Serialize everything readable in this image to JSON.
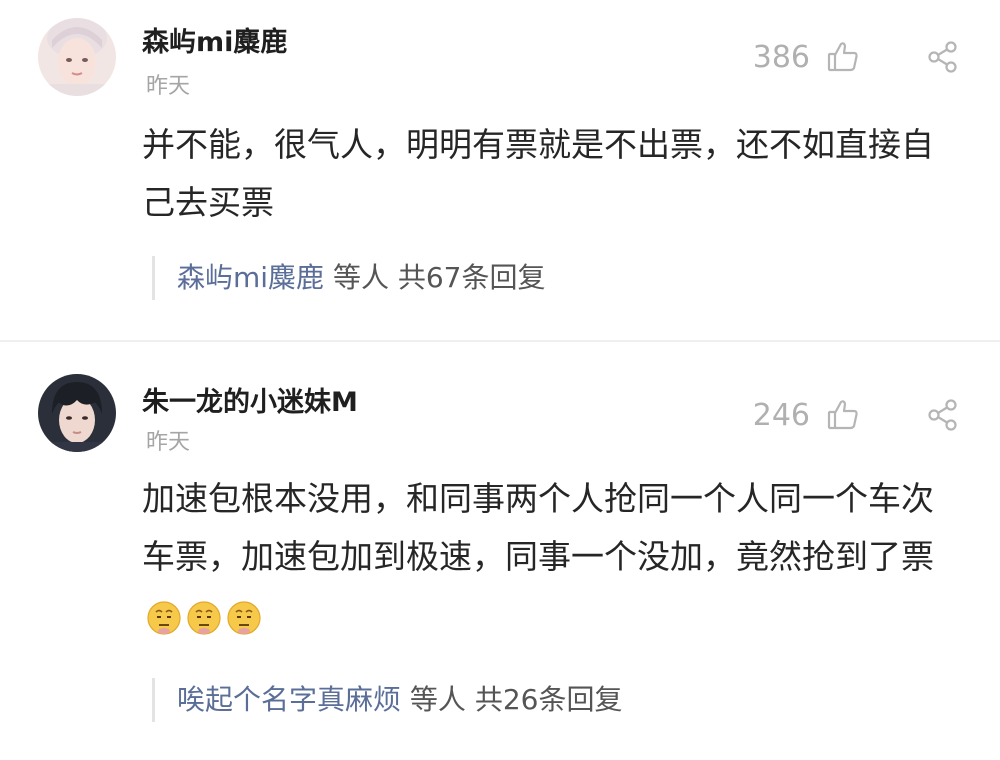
{
  "comments": [
    {
      "username": "森屿mi麋鹿",
      "time": "昨天",
      "likes": "386",
      "body": "并不能，很气人，明明有票就是不出票，还不如直接自己去买票",
      "emoji_count": 0,
      "reply_user": "森屿mi麋鹿",
      "reply_suffix": " 等人 共67条回复"
    },
    {
      "username": "朱一龙的小迷妹M",
      "time": "昨天",
      "likes": "246",
      "body": "加速包根本没用，和同事两个人抢同一个人同一个车次车票，加速包加到极速，同事一个没加，竟然抢到了票",
      "emoji_count": 3,
      "reply_user": "唉起个名字真麻烦",
      "reply_suffix": " 等人 共26条回复"
    }
  ],
  "icons": {
    "like": "thumbs-up-icon",
    "share": "share-icon",
    "emoji": "speechless-face-emoji"
  },
  "colors": {
    "reply_link": "#5a6e98",
    "muted": "#a5a5a5"
  }
}
